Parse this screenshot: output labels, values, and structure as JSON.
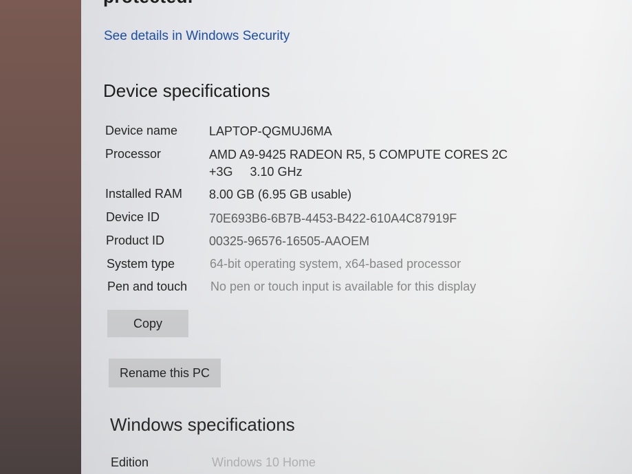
{
  "security": {
    "status_text": "protected.",
    "details_link": "See details in Windows Security"
  },
  "device_specs": {
    "heading": "Device specifications",
    "rows": [
      {
        "label": "Device name",
        "value": "LAPTOP-QGMUJ6MA"
      },
      {
        "label": "Processor",
        "value": "AMD A9-9425 RADEON R5, 5 COMPUTE CORES 2C",
        "value_line2": "+3G     3.10 GHz"
      },
      {
        "label": "Installed RAM",
        "value": "8.00 GB (6.95 GB usable)"
      },
      {
        "label": "Device ID",
        "value": "70E693B6-6B7B-4453-B422-610A4C87919F"
      },
      {
        "label": "Product ID",
        "value": "00325-96576-16505-AAOEM"
      },
      {
        "label": "System type",
        "value": "64-bit operating system, x64-based processor"
      },
      {
        "label": "Pen and touch",
        "value": "No pen or touch input is available for this display"
      }
    ],
    "copy_button": "Copy",
    "rename_button": "Rename this PC"
  },
  "windows_specs": {
    "heading": "Windows specifications",
    "rows": [
      {
        "label": "Edition",
        "value": "Windows 10 Home"
      }
    ]
  },
  "colors": {
    "link": "#1d4fa0",
    "button_bg": "#cfd0d2",
    "text": "#262626"
  }
}
